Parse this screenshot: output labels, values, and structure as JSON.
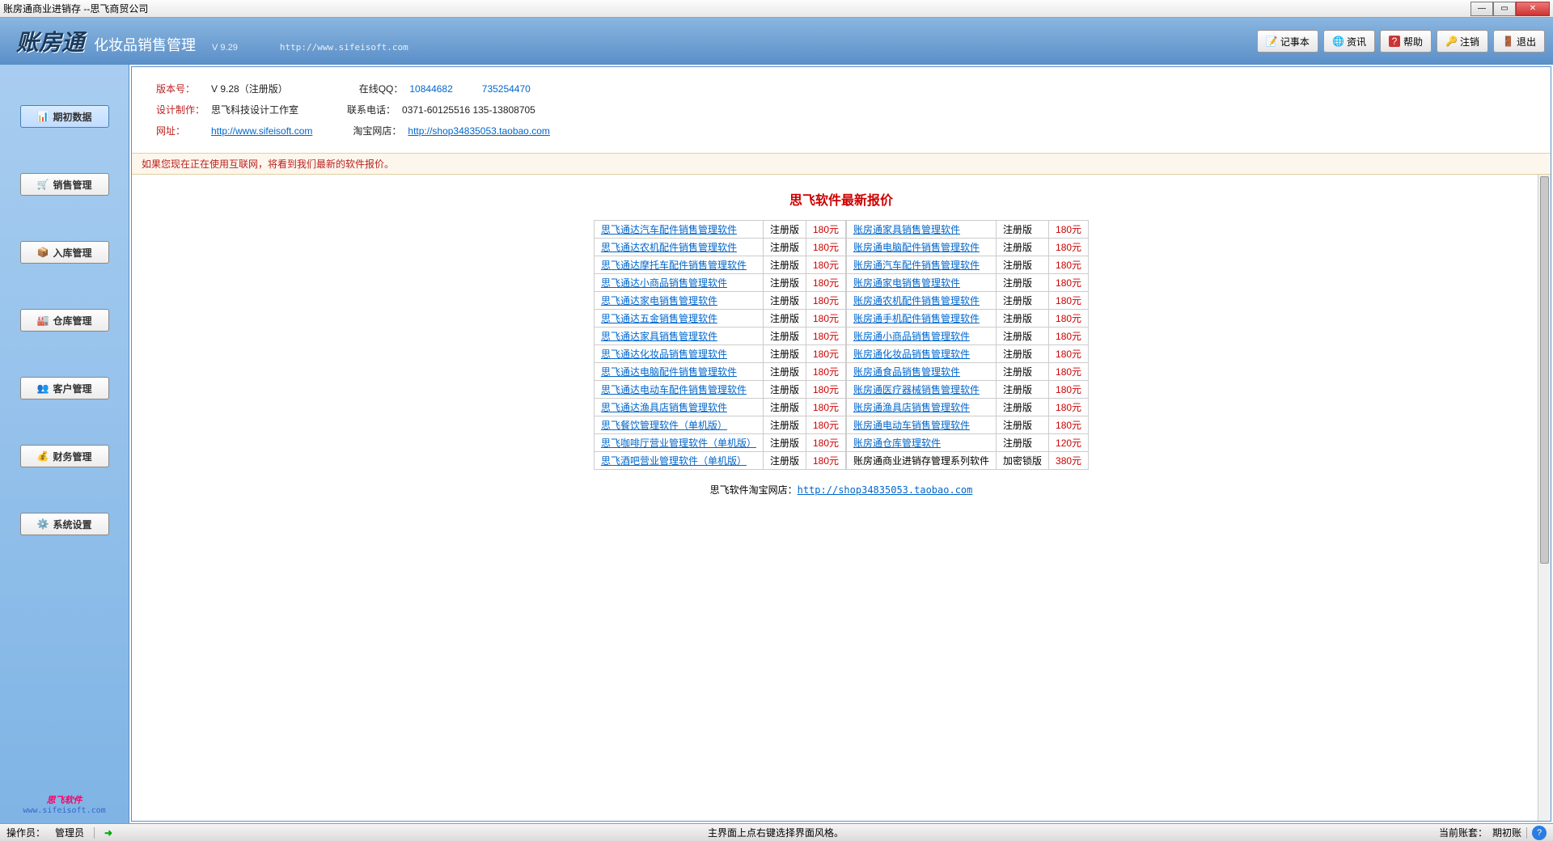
{
  "window": {
    "title": "账房通商业进销存 --思飞商贸公司"
  },
  "header": {
    "logo_main": "账房通",
    "logo_sub": "化妆品销售管理",
    "version_label": "V 9.29",
    "url": "http://www.sifeisoft.com",
    "buttons": {
      "notepad": "记事本",
      "news": "资讯",
      "help": "帮助",
      "logout": "注销",
      "exit": "退出"
    }
  },
  "sidebar": {
    "items": [
      {
        "label": "期初数据",
        "active": true
      },
      {
        "label": "销售管理",
        "active": false
      },
      {
        "label": "入库管理",
        "active": false
      },
      {
        "label": "仓库管理",
        "active": false
      },
      {
        "label": "客户管理",
        "active": false
      },
      {
        "label": "财务管理",
        "active": false
      },
      {
        "label": "系统设置",
        "active": false
      }
    ],
    "footer_brand": "思飞软件",
    "footer_url": "www.sifeisoft.com"
  },
  "info": {
    "version_label": "版本号：",
    "version_value": "V 9.28（注册版）",
    "qq_label": "在线QQ：",
    "qq1": "10844682",
    "qq2": "735254470",
    "design_label": "设计制作：",
    "design_value": "思飞科技设计工作室",
    "phone_label": "联系电话：",
    "phone_value": "0371-60125516 135-13808705",
    "site_label": "网址：",
    "site_link": "http://www.sifeisoft.com",
    "taobao_label": "淘宝网店：",
    "taobao_link": "http://shop34835053.taobao.com"
  },
  "notice": "如果您现在正在使用互联网，将看到我们最新的软件报价。",
  "price": {
    "title": "思飞软件最新报价",
    "left": [
      {
        "name": "思飞通达汽车配件销售管理软件",
        "type": "注册版",
        "price": "180元"
      },
      {
        "name": "思飞通达农机配件销售管理软件",
        "type": "注册版",
        "price": "180元"
      },
      {
        "name": "思飞通达摩托车配件销售管理软件",
        "type": "注册版",
        "price": "180元"
      },
      {
        "name": "思飞通达小商品销售管理软件",
        "type": "注册版",
        "price": "180元"
      },
      {
        "name": "思飞通达家电销售管理软件",
        "type": "注册版",
        "price": "180元"
      },
      {
        "name": "思飞通达五金销售管理软件",
        "type": "注册版",
        "price": "180元"
      },
      {
        "name": "思飞通达家具销售管理软件",
        "type": "注册版",
        "price": "180元"
      },
      {
        "name": "思飞通达化妆品销售管理软件",
        "type": "注册版",
        "price": "180元"
      },
      {
        "name": "思飞通达电脑配件销售管理软件",
        "type": "注册版",
        "price": "180元"
      },
      {
        "name": "思飞通达电动车配件销售管理软件",
        "type": "注册版",
        "price": "180元"
      },
      {
        "name": "思飞通达渔具店销售管理软件",
        "type": "注册版",
        "price": "180元"
      },
      {
        "name": "思飞餐饮管理软件（单机版）",
        "type": "注册版",
        "price": "180元"
      },
      {
        "name": "思飞咖啡厅营业管理软件（单机版）",
        "type": "注册版",
        "price": "180元"
      },
      {
        "name": "思飞酒吧营业管理软件（单机版）",
        "type": "注册版",
        "price": "180元"
      }
    ],
    "right": [
      {
        "name": "账房通家具销售管理软件",
        "type": "注册版",
        "price": "180元",
        "link": true
      },
      {
        "name": "账房通电脑配件销售管理软件",
        "type": "注册版",
        "price": "180元",
        "link": true
      },
      {
        "name": "账房通汽车配件销售管理软件",
        "type": "注册版",
        "price": "180元",
        "link": true
      },
      {
        "name": "账房通家电销售管理软件",
        "type": "注册版",
        "price": "180元",
        "link": true
      },
      {
        "name": "账房通农机配件销售管理软件",
        "type": "注册版",
        "price": "180元",
        "link": true
      },
      {
        "name": "账房通手机配件销售管理软件",
        "type": "注册版",
        "price": "180元",
        "link": true
      },
      {
        "name": "账房通小商品销售管理软件",
        "type": "注册版",
        "price": "180元",
        "link": true
      },
      {
        "name": "账房通化妆品销售管理软件",
        "type": "注册版",
        "price": "180元",
        "link": true
      },
      {
        "name": "账房通食品销售管理软件",
        "type": "注册版",
        "price": "180元",
        "link": true
      },
      {
        "name": "账房通医疗器械销售管理软件",
        "type": "注册版",
        "price": "180元",
        "link": true
      },
      {
        "name": "账房通渔具店销售管理软件",
        "type": "注册版",
        "price": "180元",
        "link": true
      },
      {
        "name": "账房通电动车销售管理软件",
        "type": "注册版",
        "price": "180元",
        "link": true
      },
      {
        "name": "账房通仓库管理软件",
        "type": "注册版",
        "price": "120元",
        "link": true
      },
      {
        "name": "账房通商业进销存管理系列软件",
        "type": "加密锁版",
        "price": "380元",
        "link": false
      }
    ],
    "taobao_prefix": "思飞软件淘宝网店：",
    "taobao_url": "http://shop34835053.taobao.com"
  },
  "statusbar": {
    "operator_label": "操作员：",
    "operator_value": "管理员",
    "hint": "主界面上点右键选择界面风格。",
    "account_label": "当前账套：",
    "account_value": "期初账"
  }
}
